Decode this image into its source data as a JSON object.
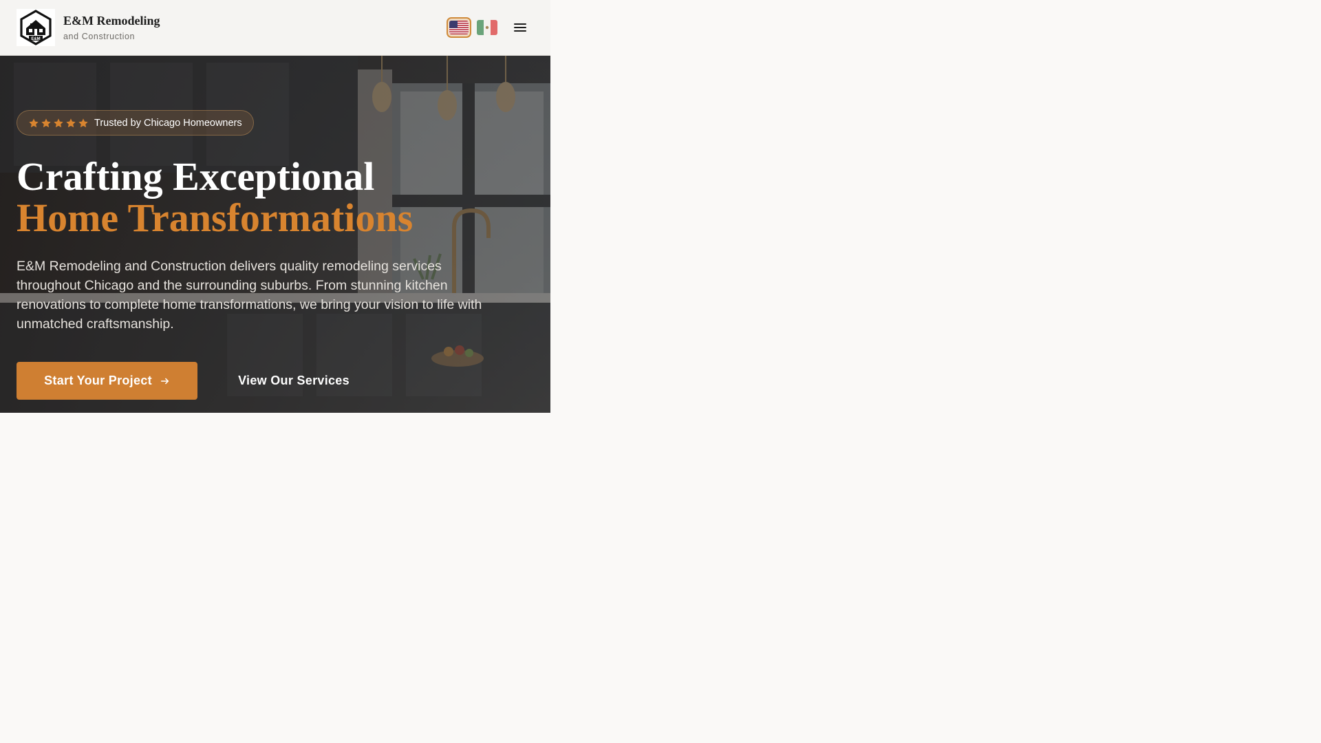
{
  "brand": {
    "name": "E&M Remodeling",
    "tagline": "and Construction",
    "logo_text": "E&M",
    "logo_icon": "house-hexagon-logo"
  },
  "header": {
    "languages": [
      {
        "code": "en",
        "icon": "us-flag-icon",
        "selected": true
      },
      {
        "code": "es",
        "icon": "mexico-flag-icon",
        "selected": false
      }
    ],
    "menu_icon": "hamburger-menu-icon"
  },
  "hero": {
    "rating": {
      "stars": 5,
      "star_icon": "star-icon",
      "text": "Trusted by Chicago Homeowners"
    },
    "headline_line1": "Crafting Exceptional",
    "headline_line2": "Home Transformations",
    "description": "E&M Remodeling and Construction delivers quality remodeling services throughout Chicago and the surrounding suburbs. From stunning kitchen renovations to complete home transformations, we bring your vision to life with unmatched craftsmanship.",
    "primary_cta": "Start Your Project",
    "primary_cta_icon": "arrow-right-icon",
    "secondary_cta": "View Our Services",
    "background_icon": "kitchen-photo-background"
  },
  "colors": {
    "accent": "#d8842f",
    "button": "#cf7f32",
    "header_bg": "#f5f4f2",
    "page_bg": "#faf9f7",
    "hero_overlay": "#221e1c"
  }
}
